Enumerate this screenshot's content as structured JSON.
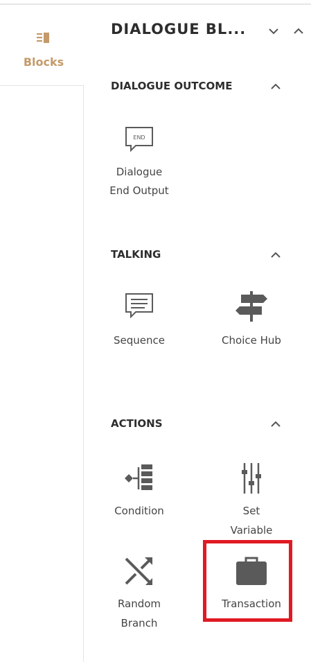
{
  "rail": {
    "blocks_tab": {
      "label": "Blocks",
      "icon": "blocks-icon"
    }
  },
  "panel": {
    "title": "DIALOGUE BL...",
    "controls": {
      "collapse_icon": "chevron-down-icon",
      "expand_icon": "chevron-up-icon"
    }
  },
  "sections": {
    "outcome": {
      "title": "DIALOGUE OUTCOME",
      "blocks": {
        "end": {
          "line1": "Dialogue",
          "line2": "End Output",
          "icon_text": "END"
        }
      }
    },
    "talking": {
      "title": "TALKING",
      "blocks": {
        "sequence": {
          "label": "Sequence"
        },
        "choice_hub": {
          "label": "Choice Hub"
        }
      }
    },
    "actions": {
      "title": "ACTIONS",
      "blocks": {
        "condition": {
          "label": "Condition"
        },
        "set_variable": {
          "line1": "Set",
          "line2": "Variable"
        },
        "random_branch": {
          "line1": "Random",
          "line2": "Branch"
        },
        "transaction": {
          "label": "Transaction"
        }
      }
    }
  },
  "colors": {
    "accent": "#c49a6a",
    "icon": "#5a5a5a",
    "highlight": "#e01a22"
  }
}
